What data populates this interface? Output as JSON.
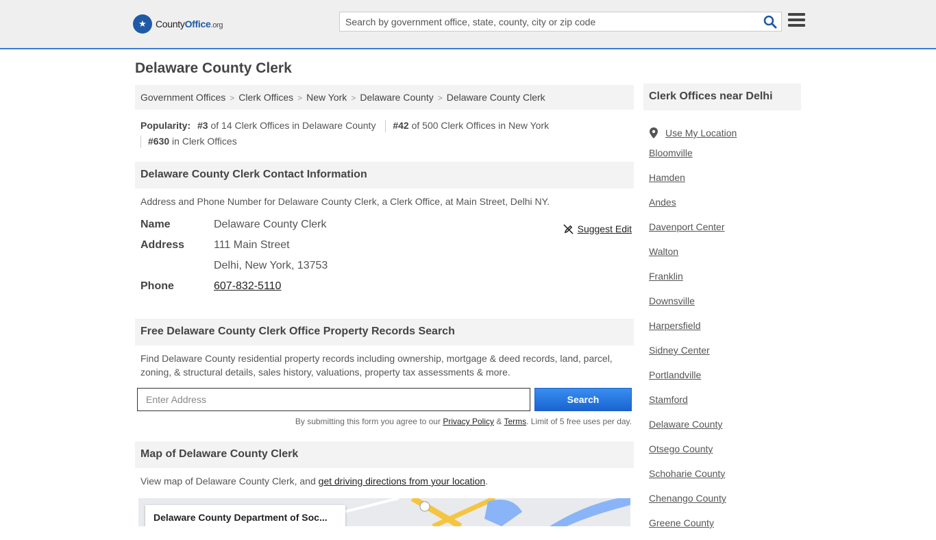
{
  "header": {
    "logo": {
      "part1": "County",
      "part2": "Office",
      "part3": ".org"
    },
    "search_placeholder": "Search by government office, state, county, city or zip code"
  },
  "page_title": "Delaware County Clerk",
  "breadcrumbs": [
    "Government Offices",
    "Clerk Offices",
    "New York",
    "Delaware County",
    "Delaware County Clerk"
  ],
  "popularity": {
    "label": "Popularity:",
    "rank1": "#3",
    "text1": " of 14 Clerk Offices in Delaware County",
    "rank2": "#42",
    "text2": " of 500 Clerk Offices in New York",
    "rank3": "#630",
    "text3": " in Clerk Offices"
  },
  "contact": {
    "heading": "Delaware County Clerk Contact Information",
    "description": "Address and Phone Number for Delaware County Clerk, a Clerk Office, at Main Street, Delhi NY.",
    "name_label": "Name",
    "name": "Delaware County Clerk",
    "address_label": "Address",
    "address1": "111 Main Street",
    "address2": "Delhi, New York, 13753",
    "phone_label": "Phone",
    "phone": "607-832-5110",
    "suggest_edit": "Suggest Edit"
  },
  "records": {
    "heading": "Free Delaware County Clerk Office Property Records Search",
    "description": "Find Delaware County residential property records including ownership, mortgage & deed records, land, parcel, zoning, & structural details, sales history, valuations, property tax assessments & more.",
    "input_placeholder": "Enter Address",
    "search_button": "Search",
    "fine_pre": "By submitting this form you agree to our ",
    "privacy": "Privacy Policy",
    "amp": " & ",
    "terms": "Terms",
    "fine_post": ". Limit of 5 free uses per day."
  },
  "map": {
    "heading": "Map of Delaware County Clerk",
    "desc_pre": "View map of Delaware County Clerk, and ",
    "desc_link": "get driving directions from your location",
    "desc_post": ".",
    "card_title": "Delaware County Department of Soc..."
  },
  "sidebar": {
    "heading": "Clerk Offices near Delhi",
    "use_location": "Use My Location",
    "items": [
      "Bloomville",
      "Hamden",
      "Andes",
      "Davenport Center",
      "Walton",
      "Franklin",
      "Downsville",
      "Harpersfield",
      "Sidney Center",
      "Portlandville",
      "Stamford",
      "Delaware County",
      "Otsego County",
      "Schoharie County",
      "Chenango County",
      "Greene County"
    ]
  },
  "colors": {
    "accent": "#1f5aa6",
    "button": "#1a63d1",
    "section_bg": "#f3f3f3"
  }
}
